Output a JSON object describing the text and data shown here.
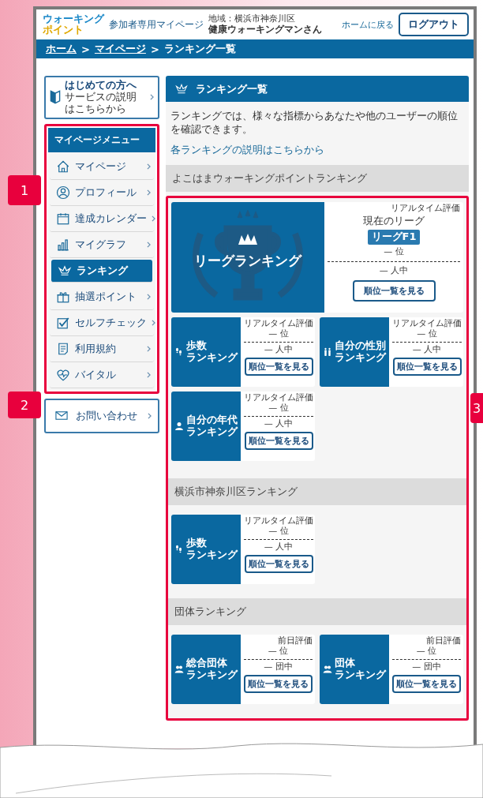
{
  "header": {
    "logo_lines": [
      "ウォーキング",
      "ポイント"
    ],
    "title": "参加者専用マイページ",
    "region": "地域：横浜市神奈川区",
    "user": "健康ウォーキングマンさん",
    "home_link": "ホームに戻る",
    "logout": "ログアウト"
  },
  "breadcrumb": [
    {
      "kind": "link",
      "label": "ホーム"
    },
    {
      "kind": "sep",
      "label": ">"
    },
    {
      "kind": "link",
      "label": "マイページ"
    },
    {
      "kind": "sep",
      "label": ">"
    },
    {
      "kind": "current",
      "label": "ランキング一覧"
    }
  ],
  "sidebar": {
    "intro": {
      "title": "はじめての方へ",
      "subtitle": "サービスの説明はこちらから"
    },
    "menu": {
      "title": "マイページメニュー",
      "items": [
        {
          "kind": "home",
          "label": "マイページ",
          "selected": false
        },
        {
          "kind": "profile",
          "label": "プロフィール",
          "selected": false
        },
        {
          "kind": "calendar",
          "label": "達成カレンダー",
          "selected": false
        },
        {
          "kind": "graph",
          "label": "マイグラフ",
          "selected": false
        },
        {
          "kind": "ranking",
          "label": "ランキング",
          "selected": true
        },
        {
          "kind": "gift",
          "label": "抽選ポイント",
          "selected": false
        },
        {
          "kind": "check",
          "label": "セルフチェック",
          "selected": false
        },
        {
          "kind": "terms",
          "label": "利用規約",
          "selected": false
        },
        {
          "kind": "vital",
          "label": "バイタル",
          "selected": false
        }
      ]
    },
    "contact": {
      "label": "お問い合わせ"
    }
  },
  "main": {
    "title": "ランキング一覧",
    "intro": "ランキングでは、様々な指標からあなたや他のユーザーの順位を確認できます。",
    "help_link": "各ランキングの説明はこちらから",
    "sections": [
      {
        "title": "よこはまウォーキングポイントランキング",
        "cards": [
          {
            "kind": "league",
            "title_lines": [
              "リーグランキング"
            ],
            "mode": "リアルタイム評価",
            "league_label": "現在のリーグ",
            "league": "リーグF1",
            "rank": "—",
            "rank_unit": "位",
            "total": "—",
            "total_unit": "人中",
            "button": "順位一覧を見る"
          },
          {
            "kind": "steps",
            "title_lines": [
              "歩数",
              "ランキング"
            ],
            "mode": "リアルタイム評価",
            "rank": "—",
            "rank_unit": "位",
            "total": "—",
            "total_unit": "人中",
            "button": "順位一覧を見る"
          },
          {
            "kind": "gender",
            "title_lines": [
              "自分の性別",
              "ランキング"
            ],
            "mode": "リアルタイム評価",
            "rank": "—",
            "rank_unit": "位",
            "total": "—",
            "total_unit": "人中",
            "button": "順位一覧を見る"
          },
          {
            "kind": "age",
            "title_lines": [
              "自分の年代",
              "ランキング"
            ],
            "mode": "リアルタイム評価",
            "rank": "—",
            "rank_unit": "位",
            "total": "—",
            "total_unit": "人中",
            "button": "順位一覧を見る"
          }
        ]
      },
      {
        "title": "横浜市神奈川区ランキング",
        "cards": [
          {
            "kind": "steps",
            "title_lines": [
              "歩数",
              "ランキング"
            ],
            "mode": "リアルタイム評価",
            "rank": "—",
            "rank_unit": "位",
            "total": "—",
            "total_unit": "人中",
            "button": "順位一覧を見る"
          }
        ]
      },
      {
        "title": "団体ランキング",
        "cards": [
          {
            "kind": "group",
            "title_lines": [
              "総合団体",
              "ランキング"
            ],
            "mode": "前日評価",
            "rank": "—",
            "rank_unit": "位",
            "total": "—",
            "total_unit": "団中",
            "button": "順位一覧を見る"
          },
          {
            "kind": "group",
            "title_lines": [
              "団体",
              "ランキング"
            ],
            "mode": "前日評価",
            "rank": "—",
            "rank_unit": "位",
            "total": "—",
            "total_unit": "団中",
            "button": "順位一覧を見る"
          }
        ]
      }
    ]
  },
  "annotations": [
    {
      "label": "1"
    },
    {
      "label": "2"
    },
    {
      "label": "3"
    }
  ]
}
